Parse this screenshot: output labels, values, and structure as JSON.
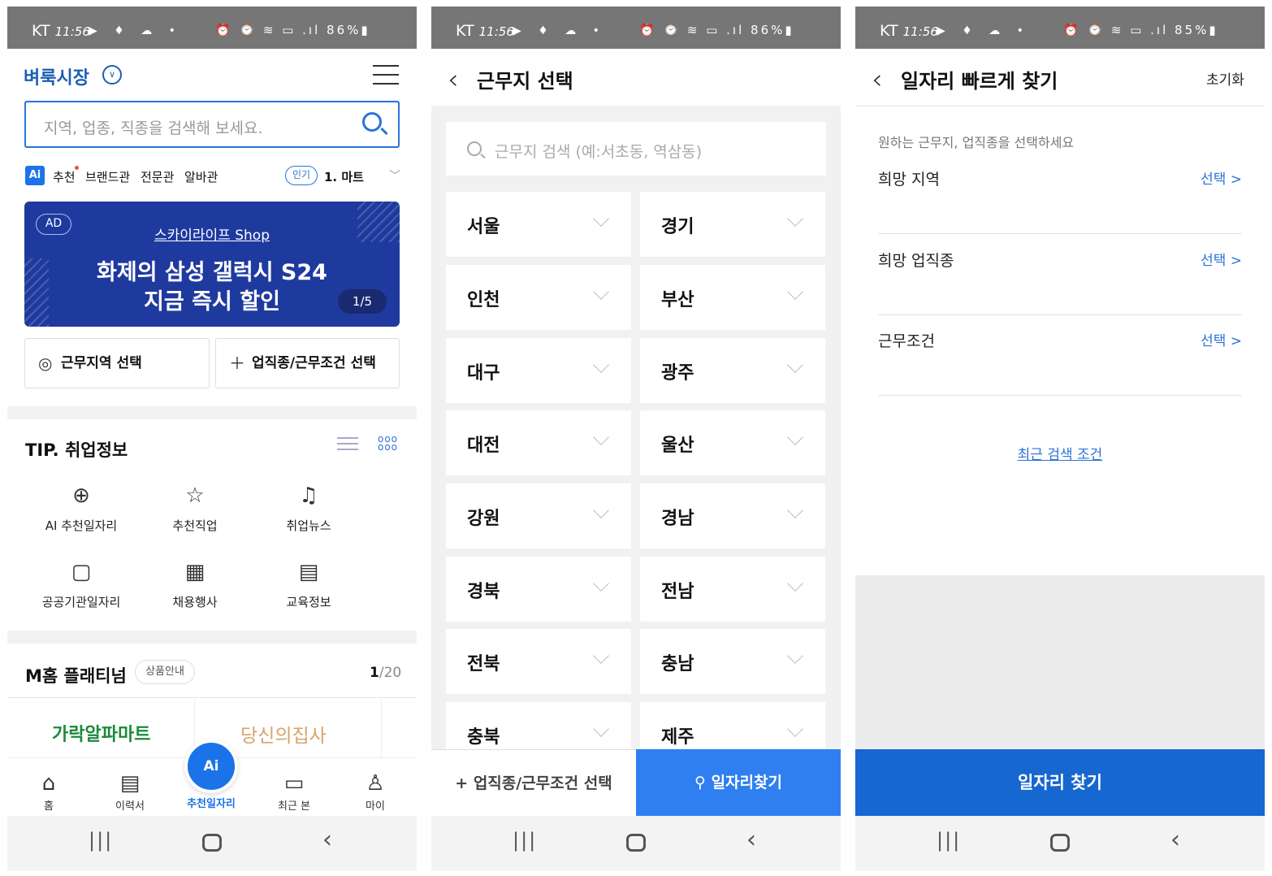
{
  "status": {
    "s1": {
      "carrier": "KT",
      "time": "11:56",
      "battery": "86%"
    },
    "s2": {
      "carrier": "KT",
      "time": "11:56",
      "battery": "86%"
    },
    "s3": {
      "carrier": "KT",
      "time": "11:56",
      "battery": "85%"
    }
  },
  "screen1": {
    "logo": "벼룩시장",
    "search_placeholder": "지역, 업종, 직종을 검색해 보세요.",
    "tabs": [
      "추천",
      "브랜드관",
      "전문관",
      "알바관"
    ],
    "ai_badge": "Ai",
    "popular_badge": "인기",
    "popular_rank": "1. 마트",
    "banner": {
      "ad": "AD",
      "shop": "스카이라이프 Shop",
      "line1": "화제의 삼성 갤럭시 S24",
      "line2": "지금 즉시 할인",
      "page": "1/5"
    },
    "select_region": "근무지역 선택",
    "select_job": "업직종/근무조건 선택",
    "tip_title": "TIP. 취업정보",
    "tip_items": [
      {
        "icon": "ai-search-icon",
        "label": "AI 추천일자리"
      },
      {
        "icon": "star-icon",
        "label": "추천직업"
      },
      {
        "icon": "bell-icon",
        "label": "취업뉴스"
      },
      {
        "icon": "briefcase-icon",
        "label": "공공기관일자리"
      },
      {
        "icon": "calendar-icon",
        "label": "채용행사"
      },
      {
        "icon": "book-icon",
        "label": "교육정보"
      }
    ],
    "mhome_title": "M홈 플래티넘",
    "mhome_badge": "상품안내",
    "mhome_page_current": "1",
    "mhome_page_total": "/20",
    "brand1": "가락알파마트",
    "brand2": "당신의집사",
    "bottom_nav": [
      "홈",
      "이력서",
      "추천일자리",
      "최근 본",
      "마이"
    ]
  },
  "screen2": {
    "title": "근무지 선택",
    "search_placeholder": "근무지 검색 (예:서초동, 역삼동)",
    "regions": [
      "서울",
      "경기",
      "인천",
      "부산",
      "대구",
      "광주",
      "대전",
      "울산",
      "강원",
      "경남",
      "경북",
      "전남",
      "전북",
      "충남",
      "충북",
      "제주"
    ],
    "footer_left": "+ 업직종/근무조건 선택",
    "footer_right": "일자리찾기"
  },
  "screen3": {
    "title": "일자리 빠르게 찾기",
    "reset": "초기화",
    "guide": "원하는 근무지, 업직종을 선택하세요",
    "rows": [
      {
        "label": "희망 지역",
        "action": "선택 >"
      },
      {
        "label": "희망 업직종",
        "action": "선택 >"
      },
      {
        "label": "근무조건",
        "action": "선택 >"
      }
    ],
    "recent": "최근 검색 조건",
    "button": "일자리 찾기"
  },
  "colors": {
    "brand_blue": "#1a73e8",
    "button_blue": "#1767d0",
    "status_grey": "#767676"
  }
}
